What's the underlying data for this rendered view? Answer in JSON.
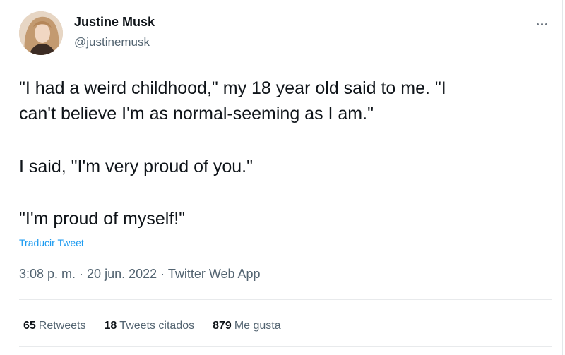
{
  "author": {
    "name": "Justine Musk",
    "handle": "@justinemusk"
  },
  "tweet": {
    "line1": "\"I had a weird childhood,\" my 18 year old said to me. \"I",
    "line2": "can't believe I'm as normal-seeming as I am.\"",
    "line3": "I said, \"I'm very proud of you.\"",
    "line4": "\"I'm proud of myself!\""
  },
  "translate_label": "Traducir Tweet",
  "meta": {
    "time": "3:08 p. m.",
    "sep1": " · ",
    "date": "20 jun. 2022",
    "sep2": " · ",
    "source": "Twitter Web App"
  },
  "stats": {
    "retweets_count": "65",
    "retweets_label": "Retweets",
    "quotes_count": "18",
    "quotes_label": "Tweets citados",
    "likes_count": "879",
    "likes_label": "Me gusta"
  },
  "icons": {
    "more": "more-horizontal-icon"
  },
  "colors": {
    "link": "#1d9bf0",
    "secondary_text": "#536471",
    "primary_text": "#0f1419"
  }
}
